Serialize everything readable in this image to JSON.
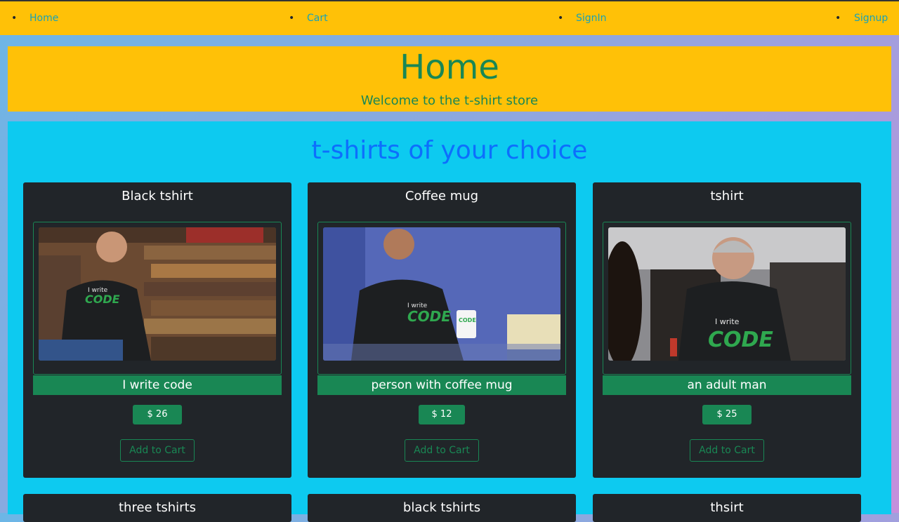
{
  "nav": {
    "items": [
      {
        "label": "Home"
      },
      {
        "label": "Cart"
      },
      {
        "label": "SignIn"
      },
      {
        "label": "Signup"
      }
    ]
  },
  "hero": {
    "title": "Home",
    "subtitle": "Welcome to the t-shirt store"
  },
  "main": {
    "heading": "t-shirts of your choice"
  },
  "products": [
    {
      "name": "Black tshirt",
      "description": "I write code",
      "price": "$ 26",
      "button": "Add to Cart",
      "image": "man-in-black-tshirt-wood-wall"
    },
    {
      "name": "Coffee mug",
      "description": "person with coffee mug",
      "price": "$ 12",
      "button": "Add to Cart",
      "image": "man-holding-coffee-mug"
    },
    {
      "name": "tshirt",
      "description": "an adult man",
      "price": "$ 25",
      "button": "Add to Cart",
      "image": "smiling-older-man"
    },
    {
      "name": "three tshirts"
    },
    {
      "name": "black tshirts"
    },
    {
      "name": "thsirt"
    }
  ],
  "colors": {
    "nav_bg": "#ffc107",
    "link": "#17a2b8",
    "success": "#198754",
    "card_bg": "#212529",
    "main_bg": "#0dcaf0",
    "heading": "#0d6efd"
  }
}
